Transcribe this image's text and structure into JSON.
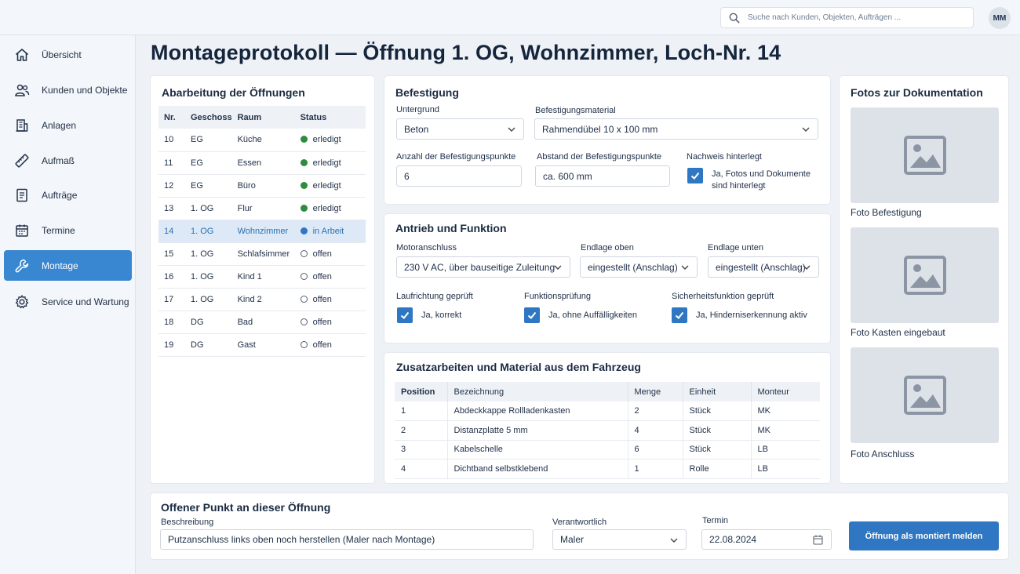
{
  "search": {
    "placeholder": "Suche nach Kunden, Objekten, Aufträgen ..."
  },
  "user": {
    "initials": "MM"
  },
  "nav": [
    {
      "label": "Übersicht",
      "icon": "home-icon"
    },
    {
      "label": "Kunden und Objekte",
      "icon": "users-icon"
    },
    {
      "label": "Anlagen",
      "icon": "building-icon"
    },
    {
      "label": "Aufmaß",
      "icon": "ruler-icon"
    },
    {
      "label": "Aufträge",
      "icon": "document-icon"
    },
    {
      "label": "Termine",
      "icon": "calendar-icon"
    },
    {
      "label": "Montage",
      "icon": "wrench-icon",
      "active": true
    },
    {
      "label": "Service und Wartung",
      "icon": "gear-icon"
    }
  ],
  "page": {
    "title": "Montageprotokoll — Öffnung 1. OG, Wohnzimmer, Loch-Nr. 14"
  },
  "openings": {
    "title": "Abarbeitung der Öffnungen",
    "headers": [
      "Nr.",
      "Geschoss",
      "Raum",
      "Status"
    ],
    "rows": [
      {
        "nr": "10",
        "geschoss": "EG",
        "raum": "Küche",
        "status": "erledigt",
        "state": "done"
      },
      {
        "nr": "11",
        "geschoss": "EG",
        "raum": "Essen",
        "status": "erledigt",
        "state": "done"
      },
      {
        "nr": "12",
        "geschoss": "EG",
        "raum": "Büro",
        "status": "erledigt",
        "state": "done"
      },
      {
        "nr": "13",
        "geschoss": "1. OG",
        "raum": "Flur",
        "status": "erledigt",
        "state": "done"
      },
      {
        "nr": "14",
        "geschoss": "1. OG",
        "raum": "Wohnzimmer",
        "status": "in Arbeit",
        "state": "work",
        "selected": true
      },
      {
        "nr": "15",
        "geschoss": "1. OG",
        "raum": "Schlafsimmer",
        "status": "offen",
        "state": "open"
      },
      {
        "nr": "16",
        "geschoss": "1. OG",
        "raum": "Kind 1",
        "status": "offen",
        "state": "open"
      },
      {
        "nr": "17",
        "geschoss": "1. OG",
        "raum": "Kind 2",
        "status": "offen",
        "state": "open"
      },
      {
        "nr": "18",
        "geschoss": "DG",
        "raum": "Bad",
        "status": "offen",
        "state": "open"
      },
      {
        "nr": "19",
        "geschoss": "DG",
        "raum": "Gast",
        "status": "offen",
        "state": "open"
      }
    ]
  },
  "befestigung": {
    "title": "Befestigung",
    "untergrund_label": "Untergrund",
    "untergrund_value": "Beton",
    "material_label": "Befestigungsmaterial",
    "material_value": "Rahmendübel 10 x 100 mm",
    "anzahl_label": "Anzahl der Befestigungspunkte",
    "anzahl_value": "6",
    "abstand_label": "Abstand der Befestigungspunkte",
    "abstand_value": "ca. 600 mm",
    "nachweis_label": "Nachweis hinterlegt",
    "nachweis_text": "Ja, Fotos und Dokumente sind hinterlegt"
  },
  "antrieb": {
    "title": "Antrieb und Funktion",
    "motor_label": "Motoranschluss",
    "motor_value": "230 V AC, über bauseitige Zuleitung",
    "endlage_oben_label": "Endlage oben",
    "endlage_oben_value": "eingestellt (Anschlag)",
    "endlage_unten_label": "Endlage unten",
    "endlage_unten_value": "eingestellt (Anschlag)",
    "laufrichtung_label": "Laufrichtung geprüft",
    "laufrichtung_text": "Ja, korrekt",
    "funktion_label": "Funktionsprüfung",
    "funktion_text": "Ja, ohne Auffälligkeiten",
    "sicherheit_label": "Sicherheitsfunktion geprüft",
    "sicherheit_text": "Ja, Hinderniserkennung aktiv"
  },
  "zusatz": {
    "title": "Zusatzarbeiten und Material aus dem Fahrzeug",
    "headers": [
      "Position",
      "Bezeichnung",
      "Menge",
      "Einheit",
      "Monteur"
    ],
    "rows": [
      [
        "1",
        "Abdeckkappe Rollladenkasten",
        "2",
        "Stück",
        "MK"
      ],
      [
        "2",
        "Distanzplatte 5 mm",
        "4",
        "Stück",
        "MK"
      ],
      [
        "3",
        "Kabelschelle",
        "6",
        "Stück",
        "LB"
      ],
      [
        "4",
        "Dichtband selbstklebend",
        "1",
        "Rolle",
        "LB"
      ]
    ]
  },
  "fotos": {
    "title": "Fotos zur Dokumentation",
    "items": [
      "Foto Befestigung",
      "Foto Kasten eingebaut",
      "Foto Anschluss"
    ]
  },
  "offener_punkt": {
    "title": "Offener Punkt an dieser Öffnung",
    "beschreibung_label": "Beschreibung",
    "beschreibung_value": "Putzanschluss links oben noch herstellen (Maler nach Montage)",
    "verantwortlich_label": "Verantwortlich",
    "verantwortlich_value": "Maler",
    "termin_label": "Termin",
    "termin_value": "22.08.2024",
    "submit_label": "Öffnung als montiert melden"
  },
  "colors": {
    "accent": "#2f77c2",
    "nav_active": "#3987d0",
    "done": "#2e8b3f"
  }
}
